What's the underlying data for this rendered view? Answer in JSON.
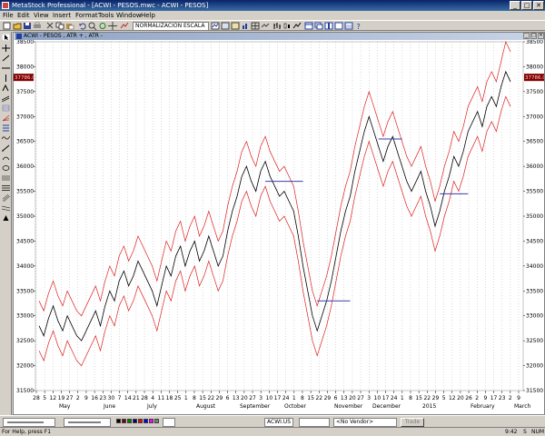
{
  "window": {
    "title": "MetaStock Professional - [ACWI - PESOS.mwc - ACWI - PESOS]",
    "minimize": "_",
    "maximize": "□",
    "close": "✕"
  },
  "menu": [
    "File",
    "Edit",
    "View",
    "Insert",
    "Format",
    "Tools",
    "Window",
    "Help"
  ],
  "toolbar": {
    "normalization_dropdown": "NORMALIZACION ESCALA"
  },
  "chart_window": {
    "title": "ACWI - PESOS , ATR + , ATR -"
  },
  "bottombar": {
    "line_style": "",
    "line_width": "",
    "symbol_dropdown": "ACWI.US",
    "vendor_dropdown": "<No Vendor>",
    "trade_button": "Trade"
  },
  "statusbar": {
    "help": "For Help, press F1",
    "time": "9:42",
    "indicator": "S",
    "num": "NUM"
  },
  "colors": {
    "price_line": "#000000",
    "band_lines": "#dc2020",
    "horizontal_markers": "#3a3aa8",
    "last_value_badge": "#800000",
    "grid": "#b4b4b4"
  },
  "chart_data": {
    "type": "line",
    "title": "",
    "xlabel": "",
    "ylabel": "",
    "ylim": [
      31500,
      38500
    ],
    "y_ticks": [
      31500,
      32000,
      32500,
      33000,
      33500,
      34000,
      34500,
      35000,
      35500,
      36000,
      36500,
      37000,
      37500,
      38000,
      38500
    ],
    "last_value_badge": "37786.0",
    "x_day_ticks": [
      "28",
      "5",
      "12",
      "19",
      "27",
      "2",
      "9",
      "16",
      "23",
      "30",
      "7",
      "14",
      "21",
      "28",
      "4",
      "11",
      "18",
      "25",
      "1",
      "8",
      "15",
      "22",
      "29",
      "6",
      "13",
      "20",
      "27",
      "3",
      "10",
      "17",
      "24",
      "1",
      "8",
      "15",
      "22",
      "29",
      "6",
      "13",
      "20",
      "27",
      "3",
      "10",
      "17",
      "24",
      "1",
      "8",
      "15",
      "22",
      "29",
      "5",
      "12",
      "20",
      "26",
      "2",
      "9",
      "17",
      "23",
      "2",
      "9"
    ],
    "x_month_labels": [
      "May",
      "June",
      "July",
      "August",
      "September",
      "October",
      "November",
      "December",
      "2015",
      "February",
      "March"
    ],
    "series": [
      {
        "color": "#000000",
        "values": [
          32800,
          32600,
          32950,
          33200,
          32900,
          32700,
          33000,
          32800,
          32600,
          32500,
          32700,
          32900,
          33100,
          32800,
          33200,
          33500,
          33300,
          33700,
          33900,
          33600,
          33800,
          34100,
          33900,
          33700,
          33500,
          33200,
          33600,
          34000,
          33800,
          34200,
          34400,
          34000,
          34300,
          34500,
          34100,
          34300,
          34600,
          34300,
          34000,
          34200,
          34700,
          35100,
          35400,
          35800,
          36000,
          35700,
          35500,
          35900,
          36100,
          35800,
          35600,
          35400,
          35500,
          35300,
          35100,
          34600,
          34000,
          33500,
          33000,
          32700,
          33000,
          33300,
          33700,
          34200,
          34700,
          35100,
          35400,
          35900,
          36300,
          36700,
          37000,
          36700,
          36400,
          36100,
          36400,
          36600,
          36300,
          36000,
          35700,
          35500,
          35700,
          35900,
          35500,
          35200,
          34800,
          35100,
          35500,
          35800,
          36200,
          36000,
          36300,
          36700,
          36900,
          37100,
          36800,
          37200,
          37400,
          37200,
          37600,
          37900,
          37700
        ]
      },
      {
        "color": "#dc2020",
        "values": [
          33300,
          33100,
          33450,
          33700,
          33400,
          33200,
          33500,
          33300,
          33100,
          33000,
          33200,
          33400,
          33600,
          33300,
          33700,
          34000,
          33800,
          34200,
          34400,
          34100,
          34300,
          34600,
          34400,
          34200,
          34000,
          33700,
          34100,
          34500,
          34300,
          34700,
          34900,
          34500,
          34800,
          35000,
          34600,
          34800,
          35100,
          34800,
          34500,
          34700,
          35200,
          35600,
          35900,
          36300,
          36500,
          36200,
          36000,
          36400,
          36600,
          36300,
          36100,
          35900,
          36000,
          35800,
          35600,
          35100,
          34500,
          34000,
          33500,
          33200,
          33500,
          33800,
          34200,
          34700,
          35200,
          35600,
          35900,
          36400,
          36800,
          37200,
          37500,
          37200,
          36900,
          36600,
          36900,
          37100,
          36800,
          36500,
          36200,
          36000,
          36200,
          36400,
          36000,
          35700,
          35300,
          35600,
          36000,
          36300,
          36700,
          36500,
          36800,
          37200,
          37400,
          37600,
          37300,
          37700,
          37900,
          37700,
          38100,
          38500,
          38300
        ]
      },
      {
        "color": "#dc2020",
        "values": [
          32300,
          32100,
          32450,
          32700,
          32400,
          32200,
          32500,
          32300,
          32100,
          32000,
          32200,
          32400,
          32600,
          32300,
          32700,
          33000,
          32800,
          33200,
          33400,
          33100,
          33300,
          33600,
          33400,
          33200,
          33000,
          32700,
          33100,
          33500,
          33300,
          33700,
          33900,
          33500,
          33800,
          34000,
          33600,
          33800,
          34100,
          33800,
          33500,
          33700,
          34200,
          34600,
          34900,
          35300,
          35500,
          35200,
          35000,
          35400,
          35600,
          35300,
          35100,
          34900,
          35000,
          34800,
          34600,
          34100,
          33500,
          33000,
          32500,
          32200,
          32500,
          32800,
          33200,
          33700,
          34200,
          34600,
          34900,
          35400,
          35800,
          36200,
          36500,
          36200,
          35900,
          35600,
          35900,
          36100,
          35800,
          35500,
          35200,
          35000,
          35200,
          35400,
          35000,
          34700,
          34300,
          34600,
          35000,
          35300,
          35700,
          35500,
          35800,
          36200,
          36400,
          36600,
          36300,
          36700,
          36900,
          36700,
          37100,
          37400,
          37200
        ]
      }
    ],
    "horizontal_markers": [
      {
        "from_index": 48,
        "to_index": 56,
        "y": 35700
      },
      {
        "from_index": 59,
        "to_index": 66,
        "y": 33300
      },
      {
        "from_index": 72,
        "to_index": 77,
        "y": 36550
      },
      {
        "from_index": 85,
        "to_index": 91,
        "y": 35450
      }
    ],
    "grid": true,
    "legend": "none"
  }
}
